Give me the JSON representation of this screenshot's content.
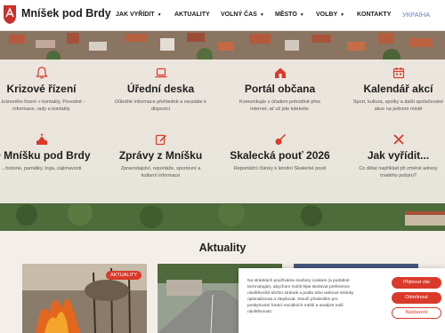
{
  "header": {
    "brand": "Mníšek pod Brdy",
    "nav": [
      {
        "label": "JAK VYŘÍDIT"
      },
      {
        "label": "AKTUALITY"
      },
      {
        "label": "VOLNÝ ČAS"
      },
      {
        "label": "MĚSTO"
      },
      {
        "label": "VOLBY"
      },
      {
        "label": "KONTAKTY"
      },
      {
        "label": "УКРАЇНА"
      }
    ]
  },
  "tiles": [
    {
      "icon": "bell-icon",
      "title": "Krizové řízení",
      "desc": "...krizového řízení + kontakty, Povodně - informace, rady a kontakty"
    },
    {
      "icon": "laptop-icon",
      "title": "Úřední deska",
      "desc": "Důležité informace přehledně a neustále k dispozici"
    },
    {
      "icon": "house-icon",
      "title": "Portál občana",
      "desc": "Komunikujte s úřadem pohodlně přes internet, ať už jste kdekoliv."
    },
    {
      "icon": "calendar-icon",
      "title": "Kalendář akcí",
      "desc": "Sport, kultura, spolky a další společenské akce na jednom místě"
    },
    {
      "icon": "church-icon",
      "title": "O Mníšku pod Brdy",
      "desc": "...historie, památky, loga, zajímavosti"
    },
    {
      "icon": "pen-icon",
      "title": "Zprávy z Mníšku",
      "desc": "Zpravodajství, reportáže, sportovní a kulturní informace"
    },
    {
      "icon": "guitar-icon",
      "title": "Skalecká pouť 2026",
      "desc": "Reportážní články k letošní Skalecké pouti"
    },
    {
      "icon": "tools-icon",
      "title": "Jak vyřídit...",
      "desc": "Co dělat například při změně adresy trvalého pobytu?"
    }
  ],
  "news": {
    "title": "Aktuality",
    "badge": "AKTUALITY"
  },
  "cookie": {
    "text": "Na stránkách používáme soubory cookies (a podobné technologie), abychom mohli lépe sledovat preference návštěvníků těchto stránek a podle toho webové stránky optimalizovat a zlepšovat. Slouží především pro poskytování funkcí sociálních médií a analýze naší návštěvnosti.",
    "accept": "Přijmout vše",
    "reject": "Odmítnout",
    "settings": "Nastavení"
  },
  "colors": {
    "accent": "#d93a2b",
    "ukraine": "#6b7fb8",
    "background": "#f3efe8"
  }
}
